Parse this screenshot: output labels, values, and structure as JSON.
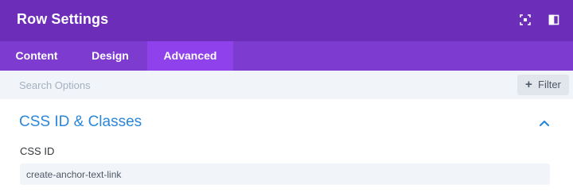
{
  "header": {
    "title": "Row Settings",
    "icons": [
      "expand-icon",
      "sidebar-toggle-icon"
    ]
  },
  "tabs": [
    {
      "label": "Content",
      "active": false
    },
    {
      "label": "Design",
      "active": false
    },
    {
      "label": "Advanced",
      "active": true
    }
  ],
  "search": {
    "placeholder": "Search Options",
    "value": ""
  },
  "filter": {
    "icon": "plus-icon",
    "label": "Filter"
  },
  "section": {
    "title": "CSS ID & Classes",
    "expanded": true,
    "toggle_icon": "chevron-up-icon"
  },
  "css_id_field": {
    "label": "CSS ID",
    "value": "create-anchor-text-link"
  },
  "colors": {
    "header_bg": "#6c2eb9",
    "tabs_bg": "#7e3bd0",
    "active_tab_bg": "#8f42ec",
    "accent": "#2b87da",
    "search_bg": "#f1f5f9"
  }
}
